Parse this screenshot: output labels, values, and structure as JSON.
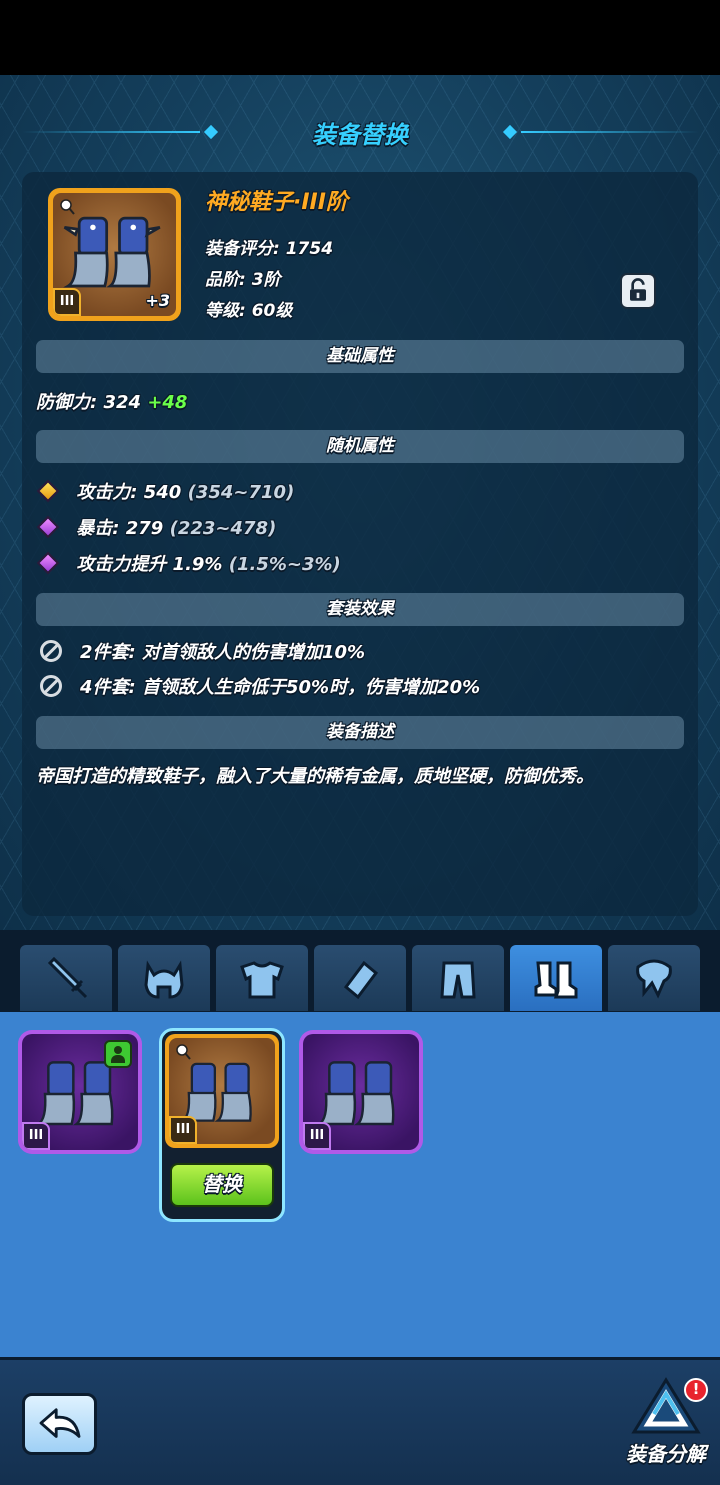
{
  "header": {
    "title": "装备替换"
  },
  "item": {
    "name": "神秘鞋子·III阶",
    "tier_roman": "III",
    "enhance": "+3",
    "score_label": "装备评分: 1754",
    "grade_label": "品阶: 3阶",
    "level_label": "等级: 60级",
    "rarity_color": "#f0a21c",
    "lock_icon": "unlock-icon"
  },
  "sections": {
    "base": "基础属性",
    "random": "随机属性",
    "set": "套装效果",
    "desc": "装备描述"
  },
  "base_stat": {
    "label": "防御力: 324",
    "bonus": "+48"
  },
  "random_stats": [
    {
      "label": "攻击力: 540",
      "range": "(354~710)",
      "gem": "gold"
    },
    {
      "label": "暴击: 279",
      "range": "(223~478)",
      "gem": "purple"
    },
    {
      "label": "攻击力提升 1.9%",
      "range": "(1.5%~3%)",
      "gem": "purple"
    }
  ],
  "set_effects": [
    {
      "text": "2件套: 对首领敌人的伤害增加10%"
    },
    {
      "text": "4件套: 首领敌人生命低于50%时，伤害增加20%"
    }
  ],
  "description": "帝国打造的精致鞋子，融入了大量的稀有金属，质地坚硬，防御优秀。",
  "tabs": [
    {
      "icon": "sword-icon"
    },
    {
      "icon": "helmet-icon"
    },
    {
      "icon": "armor-icon"
    },
    {
      "icon": "bracer-icon"
    },
    {
      "icon": "pants-icon"
    },
    {
      "icon": "boots-icon",
      "active": true
    },
    {
      "icon": "necklace-icon"
    }
  ],
  "inventory": {
    "slots": [
      {
        "tier": "III",
        "rarity_color": "#b05ae8",
        "equipped": true
      },
      {
        "tier": "III",
        "rarity_color": "#f0a21c",
        "selected": true
      },
      {
        "tier": "III",
        "rarity_color": "#b05ae8"
      }
    ],
    "replace_label": "替换"
  },
  "bottom": {
    "salvage_label": "装备分解",
    "alert": "!"
  }
}
